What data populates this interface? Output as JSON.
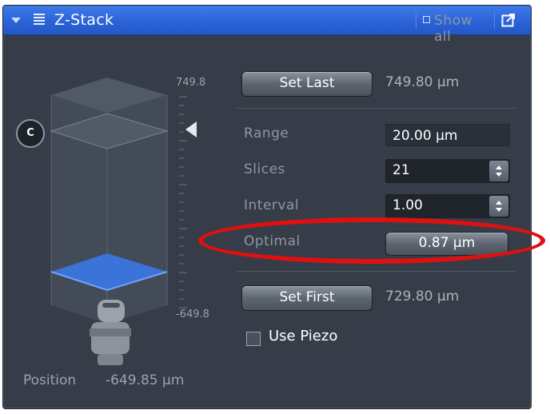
{
  "header": {
    "title": "Z-Stack",
    "show_all": "Show all"
  },
  "scale": {
    "top": "749.8",
    "bottom": "-649.8",
    "focus_marker": "C"
  },
  "set_last": {
    "label": "Set Last",
    "value": "749.80 µm"
  },
  "range": {
    "label": "Range",
    "value": "20.00 µm"
  },
  "slices": {
    "label": "Slices",
    "value": "21"
  },
  "interval": {
    "label": "Interval",
    "value": "1.00"
  },
  "optimal": {
    "label": "Optimal",
    "value": "0.87 µm"
  },
  "set_first": {
    "label": "Set First",
    "value": "729.80 µm"
  },
  "use_piezo": {
    "label": "Use Piezo",
    "checked": false
  },
  "position": {
    "label": "Position",
    "value": "-649.85 µm"
  },
  "colors": {
    "titlebar": "#2b63d8",
    "panel": "#363d48",
    "highlight_ellipse": "#e01010",
    "slice_plane": "#3b74d8"
  }
}
